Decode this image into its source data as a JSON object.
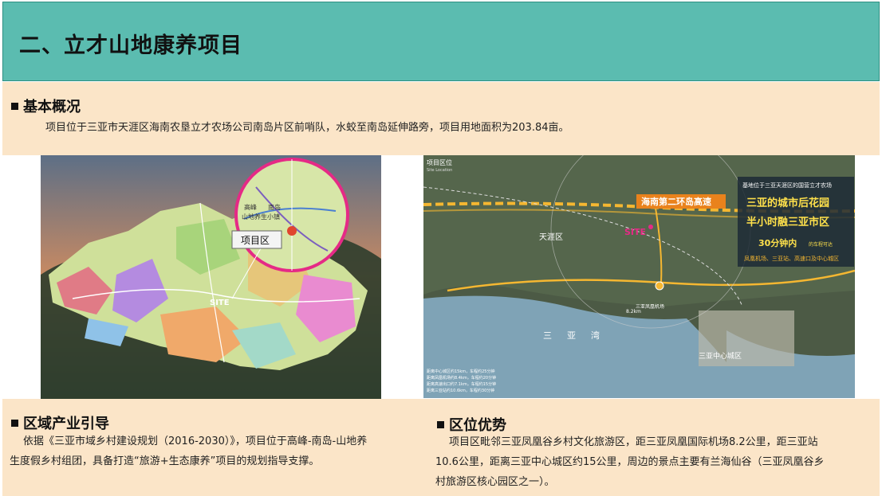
{
  "header": {
    "title": "二、立才山地康养项目"
  },
  "overview": {
    "title": "基本概况",
    "text": "项目位于三亚市天涯区海南农垦立才农场公司南岛片区前哨队，水蛟至南岛延伸路旁，项目用地面积为203.84亩。"
  },
  "left_map": {
    "marker_label": "项目区",
    "site_label": "SITE",
    "inset_label_1": "高峰",
    "inset_label_2": "南岛",
    "inset_label_3": "山地养生小镇"
  },
  "right_map": {
    "corner_title": "项目区位",
    "corner_subtitle": "Site Location",
    "highway_label": "海南第二环岛高速",
    "district_tianya": "天涯区",
    "site_label": "SITE",
    "bay_label_1": "三",
    "bay_label_2": "亚",
    "bay_label_3": "湾",
    "city_center": "三亚中心城区",
    "airport": "三亚凤凰机场",
    "airport_dist": "8.2km",
    "info_box": {
      "line1": "基地位于三亚天涯区的国营立才农场",
      "line2": "三亚的城市后花园",
      "line3": "半小时融三亚市区",
      "line4_em": "30分钟内",
      "line4_rest": "的车程可达",
      "line5": "凤凰机场、三亚站、高速口及中心城区"
    },
    "legend": [
      "距离中心城区约15km，车程约25分钟",
      "距离凤凰机场约8.4km，车程约20分钟",
      "距离高速出口约7.1km，车程约15分钟",
      "距离三亚站约10.6km，车程约30分钟"
    ]
  },
  "industry": {
    "title": "区域产业引导",
    "line1": "依据《三亚市域乡村建设规划（2016-2030）》，项目位于高峰-南岛-山地养",
    "line2": "生度假乡村组团，具备打造“旅游+生态康养”项目的规划指导支撑。"
  },
  "location": {
    "title": "区位优势",
    "line1": "项目区毗邻三亚凤凰谷乡村文化旅游区，距三亚凤凰国际机场8.2公里，距三亚站",
    "line2": "10.6公里，距离三亚中心城区约15公里，周边的景点主要有兰海仙谷（三亚凤凰谷乡",
    "line3": "村旅游区核心园区之一）。"
  },
  "colors": {
    "header_bg": "#5bbcb0",
    "band_bg": "#fbe5c8",
    "highway": "#f5b731",
    "accent_orange": "#e9821c"
  }
}
